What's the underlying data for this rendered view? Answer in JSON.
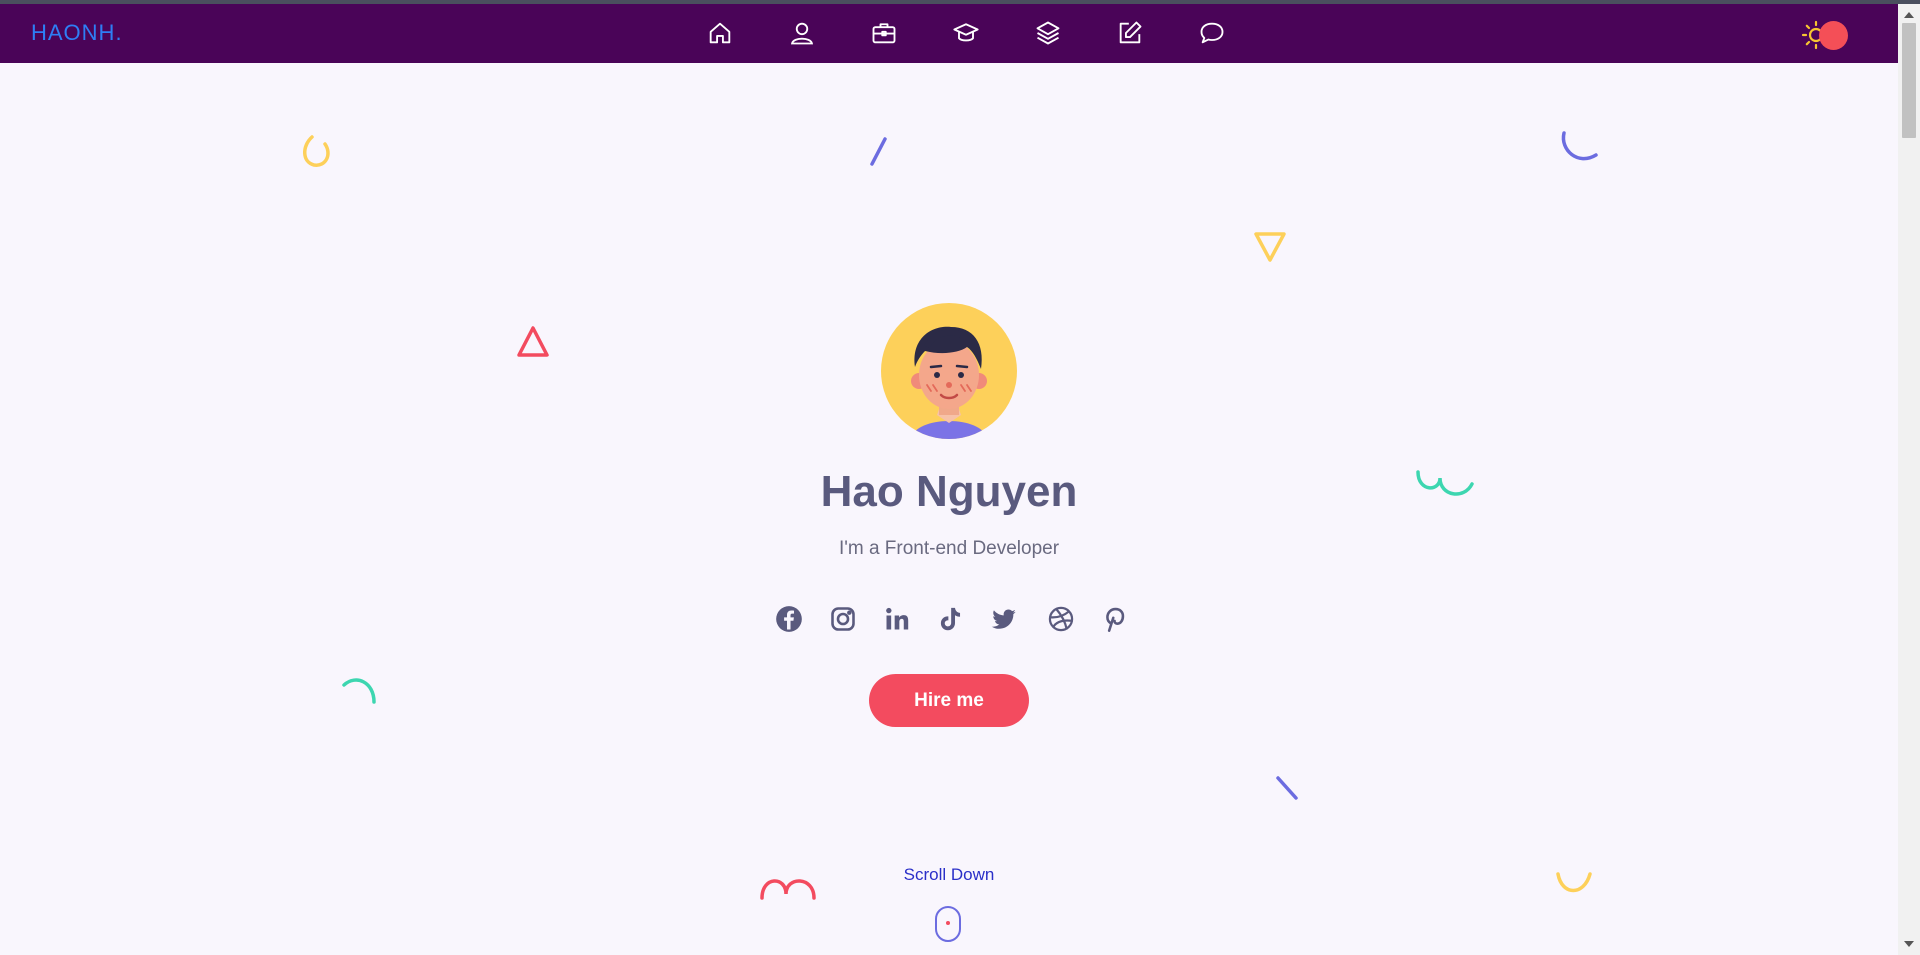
{
  "header": {
    "logo": "HAONH."
  },
  "nav": {
    "items": [
      {
        "icon": "home-icon"
      },
      {
        "icon": "user-icon"
      },
      {
        "icon": "briefcase-icon"
      },
      {
        "icon": "graduation-cap-icon"
      },
      {
        "icon": "layers-icon"
      },
      {
        "icon": "edit-icon"
      },
      {
        "icon": "chat-icon"
      }
    ]
  },
  "theme": {
    "icon": "sun-icon",
    "accent": "#f44f57"
  },
  "hero": {
    "name": "Hao Nguyen",
    "subtitle": "I'm a Front-end Developer",
    "hire_label": "Hire me",
    "scroll_label": "Scroll Down"
  },
  "socials": [
    {
      "icon": "facebook-icon"
    },
    {
      "icon": "instagram-icon"
    },
    {
      "icon": "linkedin-icon"
    },
    {
      "icon": "tiktok-icon"
    },
    {
      "icon": "twitter-icon"
    },
    {
      "icon": "dribbble-icon"
    },
    {
      "icon": "pinterest-icon"
    }
  ],
  "colors": {
    "navbar": "#4a0458",
    "background": "#f9f6fd",
    "primary": "#f34b5f",
    "text": "#5a5a7e",
    "logo": "#2e7ef5",
    "shape_yellow": "#fdd05a",
    "shape_blue": "#6c6ce0",
    "shape_green": "#3dd6b0",
    "shape_red": "#f34b5f"
  }
}
